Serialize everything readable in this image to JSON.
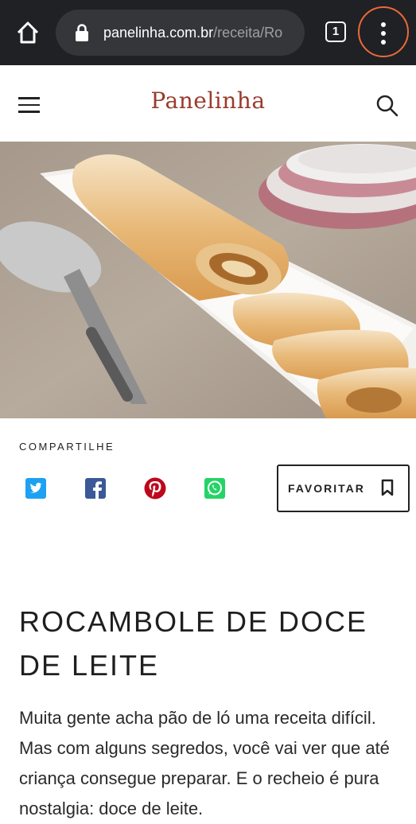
{
  "browser": {
    "url_domain": "panelinha.com.br",
    "url_path": "/receita/Ro",
    "tab_count": "1"
  },
  "site": {
    "logo": "Panelinha"
  },
  "share": {
    "label": "COMPARTILHE",
    "networks": [
      "twitter-icon",
      "facebook-icon",
      "pinterest-icon",
      "whatsapp-icon"
    ]
  },
  "favorite": {
    "label": "FAVORITAR"
  },
  "recipe": {
    "title": "ROCAMBOLE DE DOCE DE LEITE",
    "intro": "Muita gente acha pão de ló uma receita difícil. Mas com alguns segredos, você vai ver que até criança consegue preparar. E o recheio é pura nostalgia: doce de leite."
  },
  "colors": {
    "browser_bar": "#202124",
    "logo": "#9a3b2c",
    "twitter": "#1da1f2",
    "facebook": "#3b5998",
    "pinterest": "#bd081c",
    "whatsapp": "#25d366"
  }
}
